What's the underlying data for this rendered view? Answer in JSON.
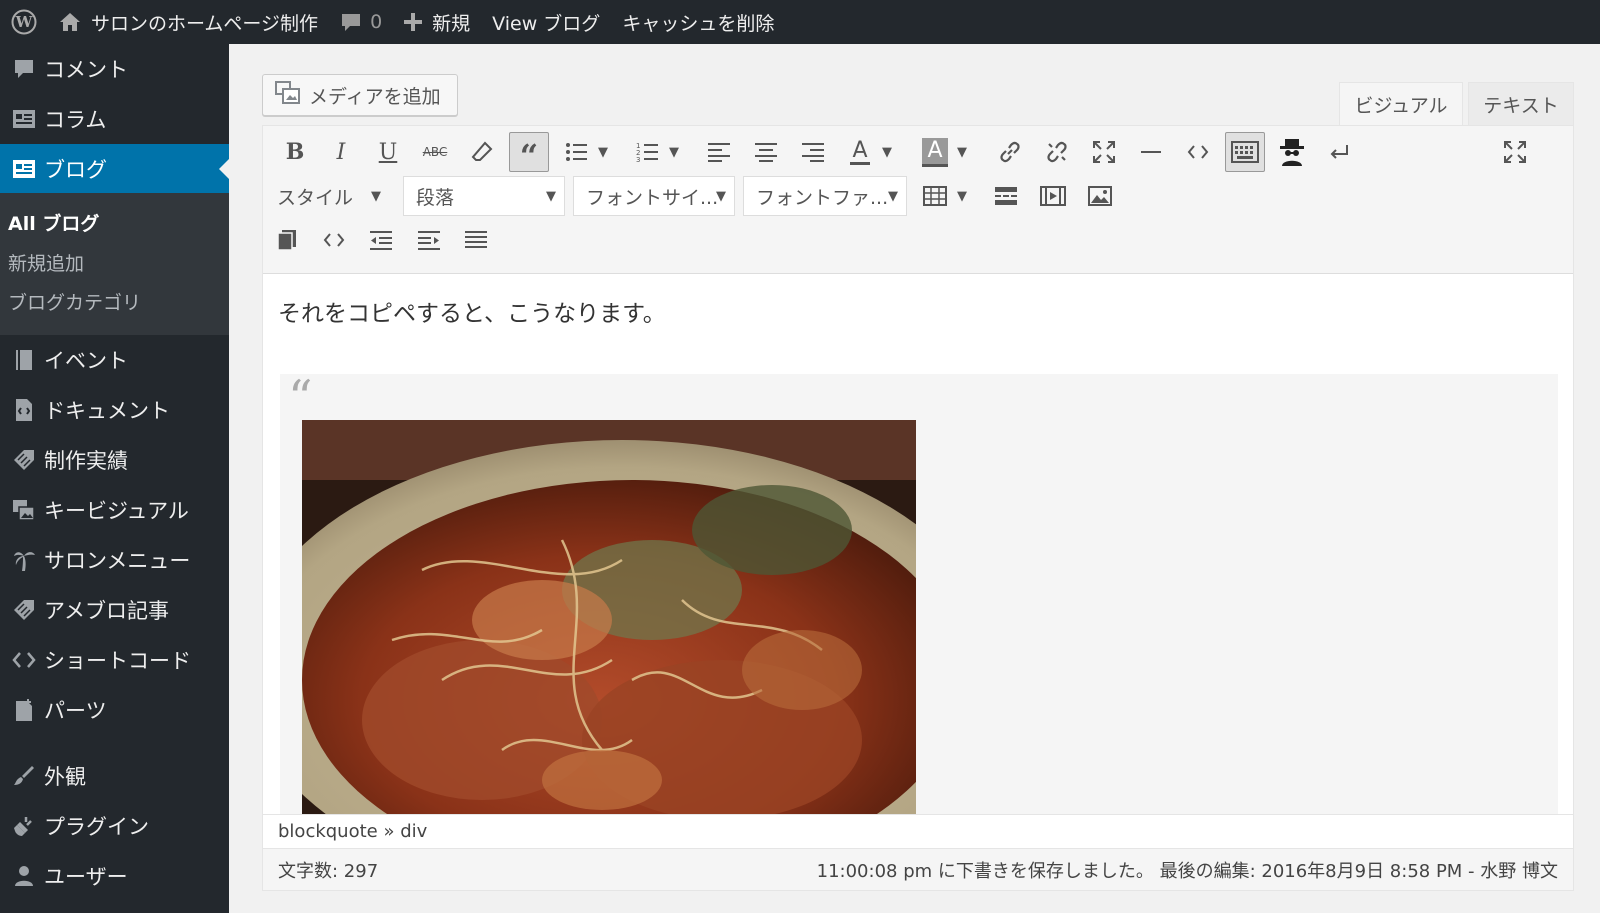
{
  "adminbar": {
    "site_name": "サロンのホームページ制作",
    "comments_count": "0",
    "new_label": "新規",
    "view_label": "View ブログ",
    "cache_label": "キャッシュを削除"
  },
  "sidebar": {
    "items": [
      {
        "label": "コメント",
        "icon": "comment-icon"
      },
      {
        "label": "コラム",
        "icon": "column-icon"
      },
      {
        "label": "ブログ",
        "icon": "blog-icon"
      },
      {
        "label": "イベント",
        "icon": "book-icon"
      },
      {
        "label": "ドキュメント",
        "icon": "document-icon"
      },
      {
        "label": "制作実績",
        "icon": "tag-icon"
      },
      {
        "label": "キービジュアル",
        "icon": "images-icon"
      },
      {
        "label": "サロンメニュー",
        "icon": "palm-icon"
      },
      {
        "label": "アメブロ記事",
        "icon": "tag-icon"
      },
      {
        "label": "ショートコード",
        "icon": "code-icon"
      },
      {
        "label": "パーツ",
        "icon": "parts-icon"
      },
      {
        "label": "外観",
        "icon": "brush-icon"
      },
      {
        "label": "プラグイン",
        "icon": "plugin-icon"
      },
      {
        "label": "ユーザー",
        "icon": "user-icon"
      }
    ],
    "submenu": [
      "All ブログ",
      "新規追加",
      "ブログカテゴリ"
    ]
  },
  "editor": {
    "add_media_label": "メディアを追加",
    "tab_visual": "ビジュアル",
    "tab_text": "テキスト",
    "style_label": "スタイル",
    "format_value": "段落",
    "font_size_value": "フォントサイ...",
    "font_family_value": "フォントファ...",
    "paragraph_text": "それをコピペすると、こうなります。",
    "element_path": "blockquote » div",
    "word_count": "文字数: 297",
    "save_status": "11:00:08 pm に下書きを保存しました。 最後の編集: 2016年8月9日 8:58 PM - 水野 博文"
  },
  "colors": {
    "adminbar_bg": "#23282d",
    "current_menu": "#0073aa",
    "submenu_bg": "#32373c"
  }
}
